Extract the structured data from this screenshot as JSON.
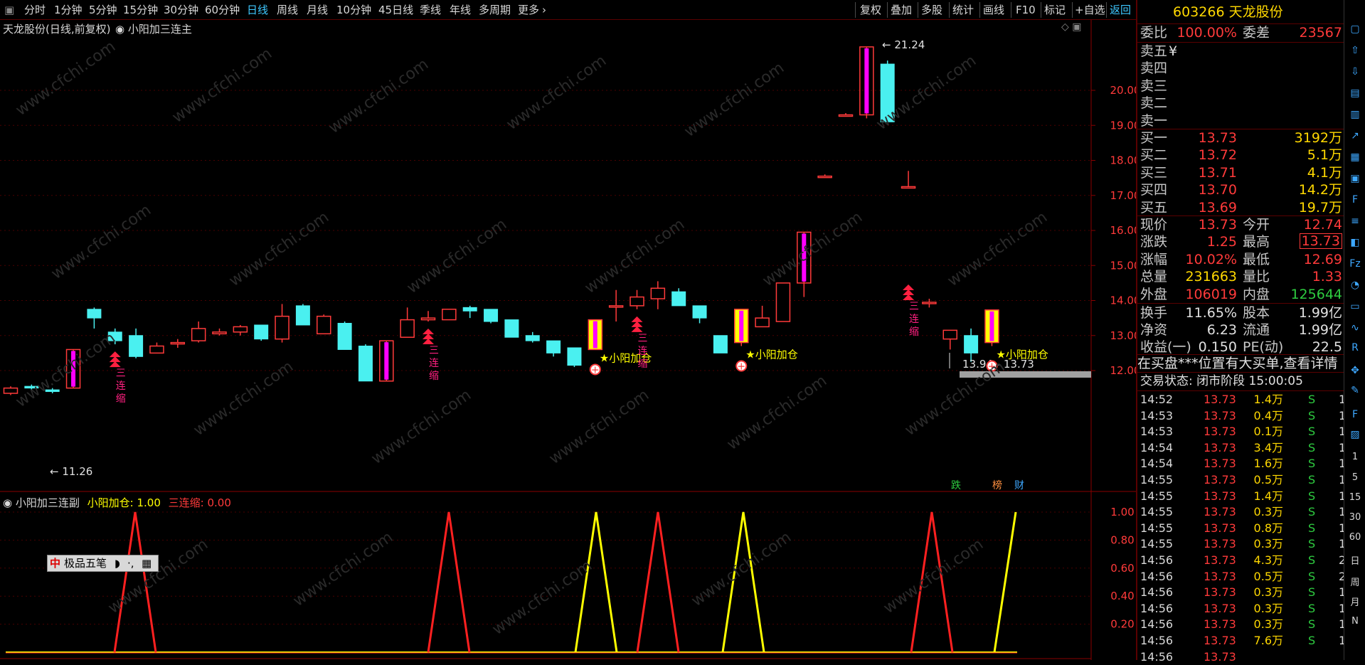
{
  "toolbar": {
    "periods": [
      "分时",
      "1分钟",
      "5分钟",
      "15分钟",
      "30分钟",
      "60分钟",
      "日线",
      "周线",
      "月线",
      "10分钟",
      "45日线",
      "季线",
      "年线",
      "多周期",
      "更多"
    ],
    "active": "日线",
    "right_buttons": [
      "复权",
      "叠加",
      "多股",
      "统计",
      "画线",
      "F10",
      "标记",
      "+自选",
      "返回"
    ]
  },
  "chart": {
    "title": "天龙股份(日线,前复权)",
    "indicator_name": "小阳加三连主",
    "sub_indicator_name": "小阳加三连副",
    "sub_legend_1": "小阳加仓: 1.00",
    "sub_legend_2": "三连缩: 0.00",
    "price_ticks": [
      "20.00",
      "19.00",
      "18.00",
      "17.00",
      "16.00",
      "15.00",
      "14.00",
      "13.00",
      "12.00"
    ],
    "sub_ticks": [
      "1.00",
      "0.80",
      "0.60",
      "0.40",
      "0.20"
    ],
    "high_label": "21.24",
    "low_label": "11.26",
    "range_label": "13.94 - 13.73",
    "signal_buy": "小阳加仓",
    "signal_shrink": "三连缩",
    "badges": [
      "跌",
      "榜",
      "财"
    ],
    "watermark": "www.cfchi.com",
    "colors": {
      "up": "#ff3a3a",
      "down": "#4af0f0",
      "limit_up": "#ff00ff",
      "signal": "#ffff00",
      "bg": "#000000"
    }
  },
  "chart_data": {
    "type": "candlestick",
    "ylim": [
      11.0,
      21.5
    ],
    "candles": [
      [
        11.35,
        11.5,
        11.3,
        11.55
      ],
      [
        11.55,
        11.5,
        11.45,
        11.6
      ],
      [
        11.45,
        11.4,
        11.35,
        11.5
      ],
      [
        11.5,
        12.6,
        11.5,
        12.6
      ],
      [
        13.75,
        13.5,
        13.2,
        13.8
      ],
      [
        13.1,
        12.85,
        12.75,
        13.2
      ],
      [
        13.0,
        12.4,
        12.35,
        13.2
      ],
      [
        12.5,
        12.7,
        12.5,
        12.8
      ],
      [
        12.8,
        12.8,
        12.65,
        12.9
      ],
      [
        12.85,
        13.2,
        12.8,
        13.4
      ],
      [
        13.05,
        13.1,
        13.0,
        13.2
      ],
      [
        13.1,
        13.25,
        13.0,
        13.3
      ],
      [
        13.3,
        12.9,
        12.85,
        13.3
      ],
      [
        12.9,
        13.55,
        12.8,
        13.9
      ],
      [
        13.85,
        13.3,
        13.3,
        13.9
      ],
      [
        13.05,
        13.55,
        13.05,
        13.6
      ],
      [
        13.35,
        12.6,
        12.6,
        13.4
      ],
      [
        12.7,
        11.7,
        11.7,
        12.75
      ],
      [
        11.7,
        12.85,
        11.7,
        12.85
      ],
      [
        12.95,
        13.45,
        12.95,
        13.8
      ],
      [
        13.45,
        13.5,
        13.4,
        13.7
      ],
      [
        13.45,
        13.75,
        13.45,
        13.75
      ],
      [
        13.8,
        13.7,
        13.5,
        13.85
      ],
      [
        13.75,
        13.4,
        13.35,
        13.75
      ],
      [
        13.45,
        12.95,
        12.95,
        13.45
      ],
      [
        13.0,
        12.85,
        12.8,
        13.1
      ],
      [
        12.85,
        12.5,
        12.4,
        12.85
      ],
      [
        12.65,
        12.15,
        12.1,
        12.65
      ],
      [
        12.6,
        13.45,
        12.6,
        13.45
      ],
      [
        13.85,
        13.85,
        13.4,
        14.3
      ],
      [
        13.85,
        14.1,
        13.75,
        14.3
      ],
      [
        14.05,
        14.35,
        13.75,
        14.55
      ],
      [
        14.25,
        13.85,
        13.85,
        14.35
      ],
      [
        13.85,
        13.5,
        13.35,
        13.85
      ],
      [
        13.0,
        12.5,
        12.5,
        13.0
      ],
      [
        12.8,
        13.75,
        12.7,
        13.75
      ],
      [
        13.25,
        13.5,
        13.25,
        13.85
      ],
      [
        13.4,
        14.5,
        13.4,
        14.5
      ],
      [
        14.5,
        15.95,
        14.1,
        15.95
      ],
      [
        17.55,
        17.55,
        17.55,
        17.6
      ],
      [
        19.3,
        19.3,
        19.3,
        19.35
      ],
      [
        19.3,
        21.24,
        19.2,
        21.24
      ],
      [
        20.75,
        19.1,
        19.1,
        20.85
      ],
      [
        17.25,
        17.25,
        17.25,
        17.7
      ],
      [
        13.95,
        13.95,
        13.8,
        14.05
      ],
      [
        12.9,
        13.15,
        12.6,
        13.15
      ],
      [
        13.0,
        12.5,
        12.25,
        13.2
      ],
      [
        12.8,
        13.73,
        12.7,
        13.73
      ]
    ],
    "limit_up_index": [
      3,
      18,
      38,
      41
    ],
    "signal_index": [
      28,
      35,
      47
    ],
    "sub_series": [
      {
        "name": "小阳加仓",
        "peaks": [
          28,
          35,
          47
        ]
      },
      {
        "name": "三连缩",
        "peaks": [
          6,
          21,
          31,
          44
        ]
      }
    ]
  },
  "quote": {
    "code": "603266",
    "name": "天龙股份",
    "weibi_label": "委比",
    "weibi": "100.00%",
    "weicha_label": "委差",
    "weicha": "23567",
    "sell": [
      {
        "label": "卖五",
        "price": "¥",
        "vol": ""
      },
      {
        "label": "卖四",
        "price": "",
        "vol": ""
      },
      {
        "label": "卖三",
        "price": "",
        "vol": ""
      },
      {
        "label": "卖二",
        "price": "",
        "vol": ""
      },
      {
        "label": "卖一",
        "price": "",
        "vol": ""
      }
    ],
    "buy": [
      {
        "label": "买一",
        "price": "13.73",
        "vol": "3192万"
      },
      {
        "label": "买二",
        "price": "13.72",
        "vol": "5.1万"
      },
      {
        "label": "买三",
        "price": "13.71",
        "vol": "4.1万"
      },
      {
        "label": "买四",
        "price": "13.70",
        "vol": "14.2万"
      },
      {
        "label": "买五",
        "price": "13.69",
        "vol": "19.7万"
      }
    ],
    "stats": [
      {
        "l1": "现价",
        "v1": "13.73",
        "c1": "red",
        "l2": "今开",
        "v2": "12.74",
        "c2": "red"
      },
      {
        "l1": "涨跌",
        "v1": "1.25",
        "c1": "red",
        "l2": "最高",
        "v2": "13.73",
        "c2": "red"
      },
      {
        "l1": "涨幅",
        "v1": "10.02%",
        "c1": "red",
        "l2": "最低",
        "v2": "12.69",
        "c2": "red"
      },
      {
        "l1": "总量",
        "v1": "231663",
        "c1": "yel",
        "l2": "量比",
        "v2": "1.33",
        "c2": "red"
      },
      {
        "l1": "外盘",
        "v1": "106019",
        "c1": "red",
        "l2": "内盘",
        "v2": "125644",
        "c2": "grn"
      }
    ],
    "stats2": [
      {
        "l1": "换手",
        "v1": "11.65%",
        "l2": "股本",
        "v2": "1.99亿"
      },
      {
        "l1": "净资",
        "v1": "6.23",
        "l2": "流通",
        "v2": "1.99亿"
      },
      {
        "l1": "收益(一)",
        "v1": "0.150",
        "l2": "PE(动)",
        "v2": "22.5"
      }
    ],
    "notice": "在买盘***位置有大买单,查看详情",
    "status": "交易状态: 闭市阶段 15:00:05"
  },
  "ticks": [
    {
      "t": "14:52",
      "p": "13.73",
      "v": "1.4万",
      "s": "S",
      "n": "1"
    },
    {
      "t": "14:53",
      "p": "13.73",
      "v": "0.4万",
      "s": "S",
      "n": "1"
    },
    {
      "t": "14:53",
      "p": "13.73",
      "v": "0.1万",
      "s": "S",
      "n": "1"
    },
    {
      "t": "14:54",
      "p": "13.73",
      "v": "3.4万",
      "s": "S",
      "n": "1"
    },
    {
      "t": "14:54",
      "p": "13.73",
      "v": "1.6万",
      "s": "S",
      "n": "1"
    },
    {
      "t": "14:55",
      "p": "13.73",
      "v": "0.5万",
      "s": "S",
      "n": "1"
    },
    {
      "t": "14:55",
      "p": "13.73",
      "v": "1.4万",
      "s": "S",
      "n": "1"
    },
    {
      "t": "14:55",
      "p": "13.73",
      "v": "0.3万",
      "s": "S",
      "n": "1"
    },
    {
      "t": "14:55",
      "p": "13.73",
      "v": "0.8万",
      "s": "S",
      "n": "1"
    },
    {
      "t": "14:55",
      "p": "13.73",
      "v": "0.3万",
      "s": "S",
      "n": "1"
    },
    {
      "t": "14:56",
      "p": "13.73",
      "v": "4.3万",
      "s": "S",
      "n": "2"
    },
    {
      "t": "14:56",
      "p": "13.73",
      "v": "0.5万",
      "s": "S",
      "n": "2"
    },
    {
      "t": "14:56",
      "p": "13.73",
      "v": "0.3万",
      "s": "S",
      "n": "1"
    },
    {
      "t": "14:56",
      "p": "13.73",
      "v": "0.3万",
      "s": "S",
      "n": "1"
    },
    {
      "t": "14:56",
      "p": "13.73",
      "v": "0.3万",
      "s": "S",
      "n": "1"
    },
    {
      "t": "14:56",
      "p": "13.73",
      "v": "7.6万",
      "s": "S",
      "n": "1"
    },
    {
      "t": "14:56",
      "p": "13.73",
      "v": "",
      "s": "",
      "n": ""
    }
  ],
  "float_toolbar": {
    "label": "极品五笔"
  },
  "iconbar_text": [
    "1",
    "5",
    "15",
    "30",
    "60",
    "日",
    "周",
    "月",
    "N"
  ]
}
